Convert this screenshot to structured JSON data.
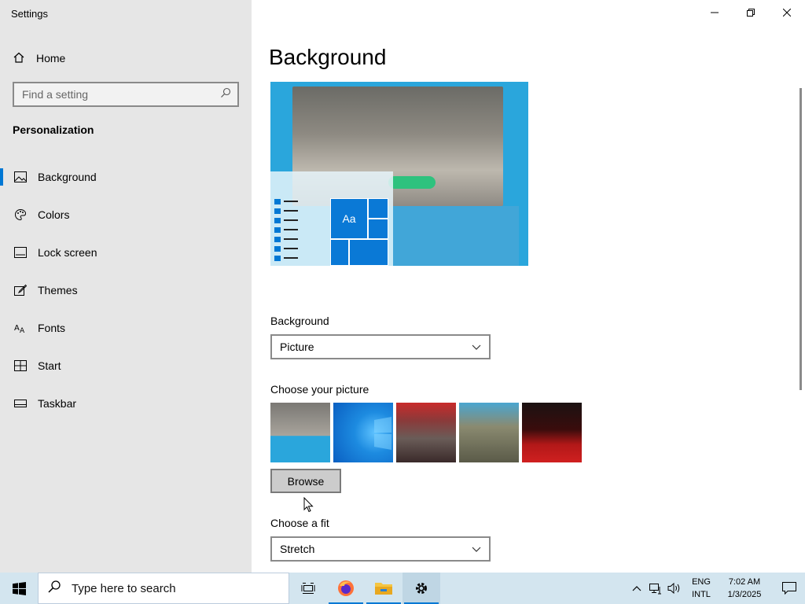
{
  "window": {
    "title": "Settings",
    "controls": {
      "minimize": "minimize",
      "restore": "restore",
      "close": "close"
    }
  },
  "sidebar": {
    "home_label": "Home",
    "search_placeholder": "Find a setting",
    "section_title": "Personalization",
    "items": [
      {
        "label": "Background",
        "icon": "picture-icon",
        "active": true
      },
      {
        "label": "Colors",
        "icon": "palette-icon",
        "active": false
      },
      {
        "label": "Lock screen",
        "icon": "lock-screen-icon",
        "active": false
      },
      {
        "label": "Themes",
        "icon": "brush-icon",
        "active": false
      },
      {
        "label": "Fonts",
        "icon": "font-icon",
        "active": false
      },
      {
        "label": "Start",
        "icon": "start-icon",
        "active": false
      },
      {
        "label": "Taskbar",
        "icon": "taskbar-icon",
        "active": false
      }
    ]
  },
  "main": {
    "title": "Background",
    "preview": {
      "tile_label": "Aa"
    },
    "background_label": "Background",
    "background_value": "Picture",
    "choose_picture_label": "Choose your picture",
    "browse_label": "Browse",
    "fit_label": "Choose a fit",
    "fit_value": "Stretch"
  },
  "taskbar": {
    "search_placeholder": "Type here to search",
    "apps": [
      "task-view-icon",
      "firefox-icon",
      "file-explorer-icon",
      "settings-icon"
    ],
    "language": {
      "line1": "ENG",
      "line2": "INTL"
    },
    "time": "7:02 AM",
    "date": "1/3/2025"
  },
  "colors": {
    "accent": "#0078d4",
    "sidebar_bg": "#e6e6e6",
    "taskbar_bg": "#d3e5ef"
  }
}
